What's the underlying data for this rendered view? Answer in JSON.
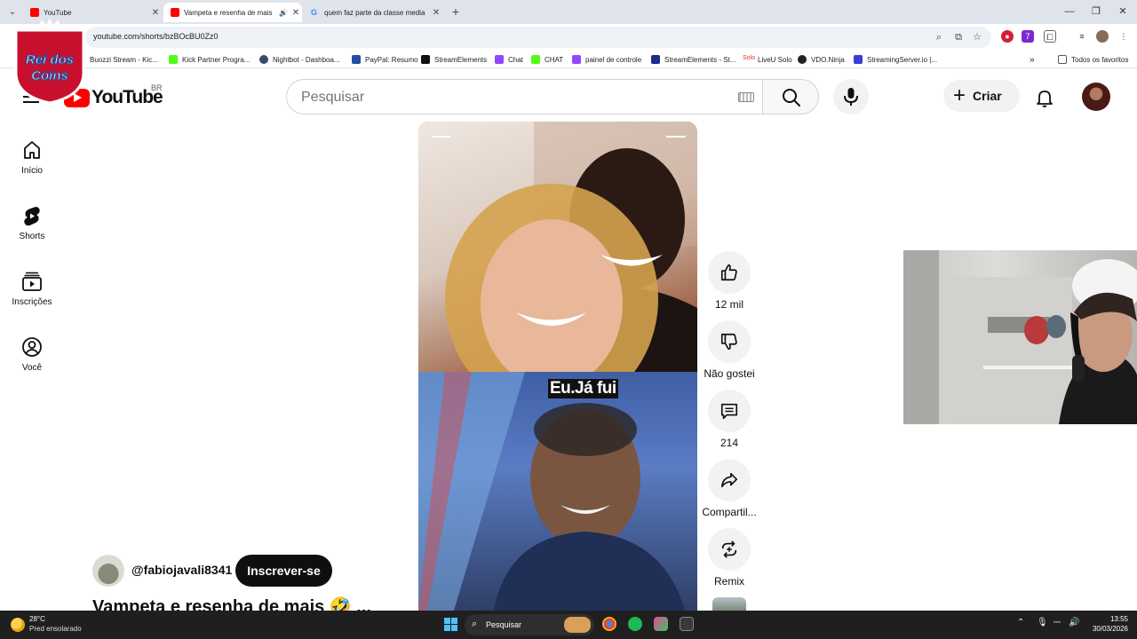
{
  "browser": {
    "tabs": [
      {
        "title": "YouTube",
        "active": false
      },
      {
        "title": "Vampeta e resenha de mais",
        "active": true
      },
      {
        "title": "quem faz parte da classe media",
        "active": false
      }
    ],
    "url": "youtube.com/shorts/bzBOcBU0Zz0",
    "bookmarks": [
      {
        "label": "Buozzi Stream - Kic...",
        "color": "#e9e9e9"
      },
      {
        "label": "Kick Partner Progra...",
        "color": "#53fc18"
      },
      {
        "label": "Nightbot - Dashboa...",
        "color": "#3a4a6b"
      },
      {
        "label": "PayPal: Resumo",
        "color": "#1f4fa3"
      },
      {
        "label": "StreamElements",
        "color": "#111111"
      },
      {
        "label": "Chat",
        "color": "#9146ff"
      },
      {
        "label": "CHAT",
        "color": "#53fc18"
      },
      {
        "label": "painel de controle",
        "color": "#9146ff"
      },
      {
        "label": "StreamElements - St...",
        "color": "#1e2b8a"
      },
      {
        "label": "LiveU Solo",
        "color": "#d33"
      },
      {
        "label": "VDO.Ninja",
        "color": "#222"
      },
      {
        "label": "StreamingServer.io |...",
        "color": "#3b3bd6"
      }
    ],
    "all_bookmarks": "Todos os favoritos"
  },
  "logo_overlay": {
    "line1": "Rei dos",
    "line2": "Coins"
  },
  "masthead": {
    "logo_word": "YouTube",
    "region": "BR",
    "search_placeholder": "Pesquisar",
    "create_label": "Criar"
  },
  "guide": [
    {
      "label": "Início",
      "icon": "home-icon"
    },
    {
      "label": "Shorts",
      "icon": "shorts-icon"
    },
    {
      "label": "Inscrições",
      "icon": "subscriptions-icon"
    },
    {
      "label": "Você",
      "icon": "you-icon"
    }
  ],
  "short": {
    "caption": "Eu.Já fui",
    "channel": "@fabiojavali8341",
    "subscribe_label": "Inscrever-se",
    "title": "Vampeta e resenha de mais 🤣 ..."
  },
  "actions": {
    "like_count": "12 mil",
    "dislike_label": "Não gostei",
    "comment_count": "214",
    "share_label": "Compartil...",
    "remix_label": "Remix"
  },
  "taskbar": {
    "temperature": "28°C",
    "weather": "Pred ensolarado",
    "search_label": "Pesquisar",
    "time": "13:55",
    "date": "30/03/2026"
  }
}
